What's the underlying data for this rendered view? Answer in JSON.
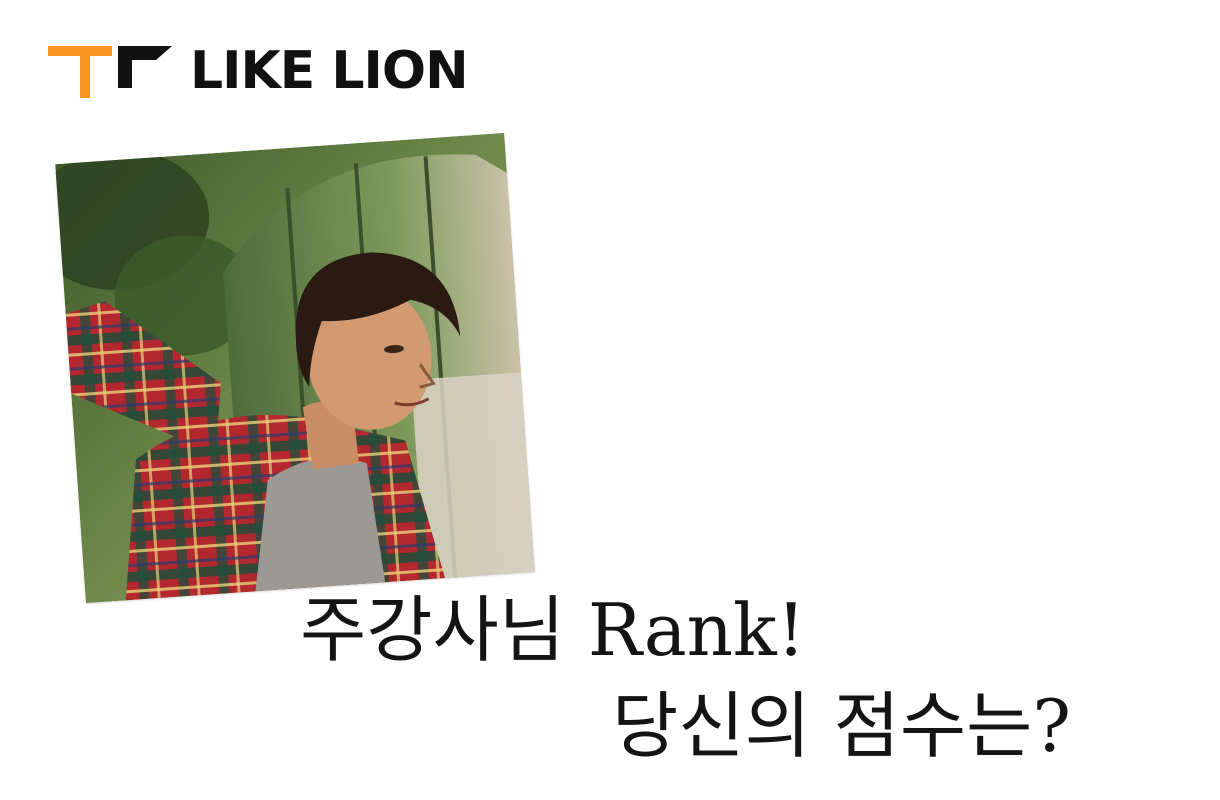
{
  "brand": {
    "name": "LIKE LION",
    "accent_color": "#F7931E",
    "text_color": "#111111",
    "icon": "like-lion-logo-icon"
  },
  "photo": {
    "subject": "instructor-photo"
  },
  "headline": {
    "line1": "주강사님 Rank!",
    "line2": "당신의 점수는?"
  }
}
